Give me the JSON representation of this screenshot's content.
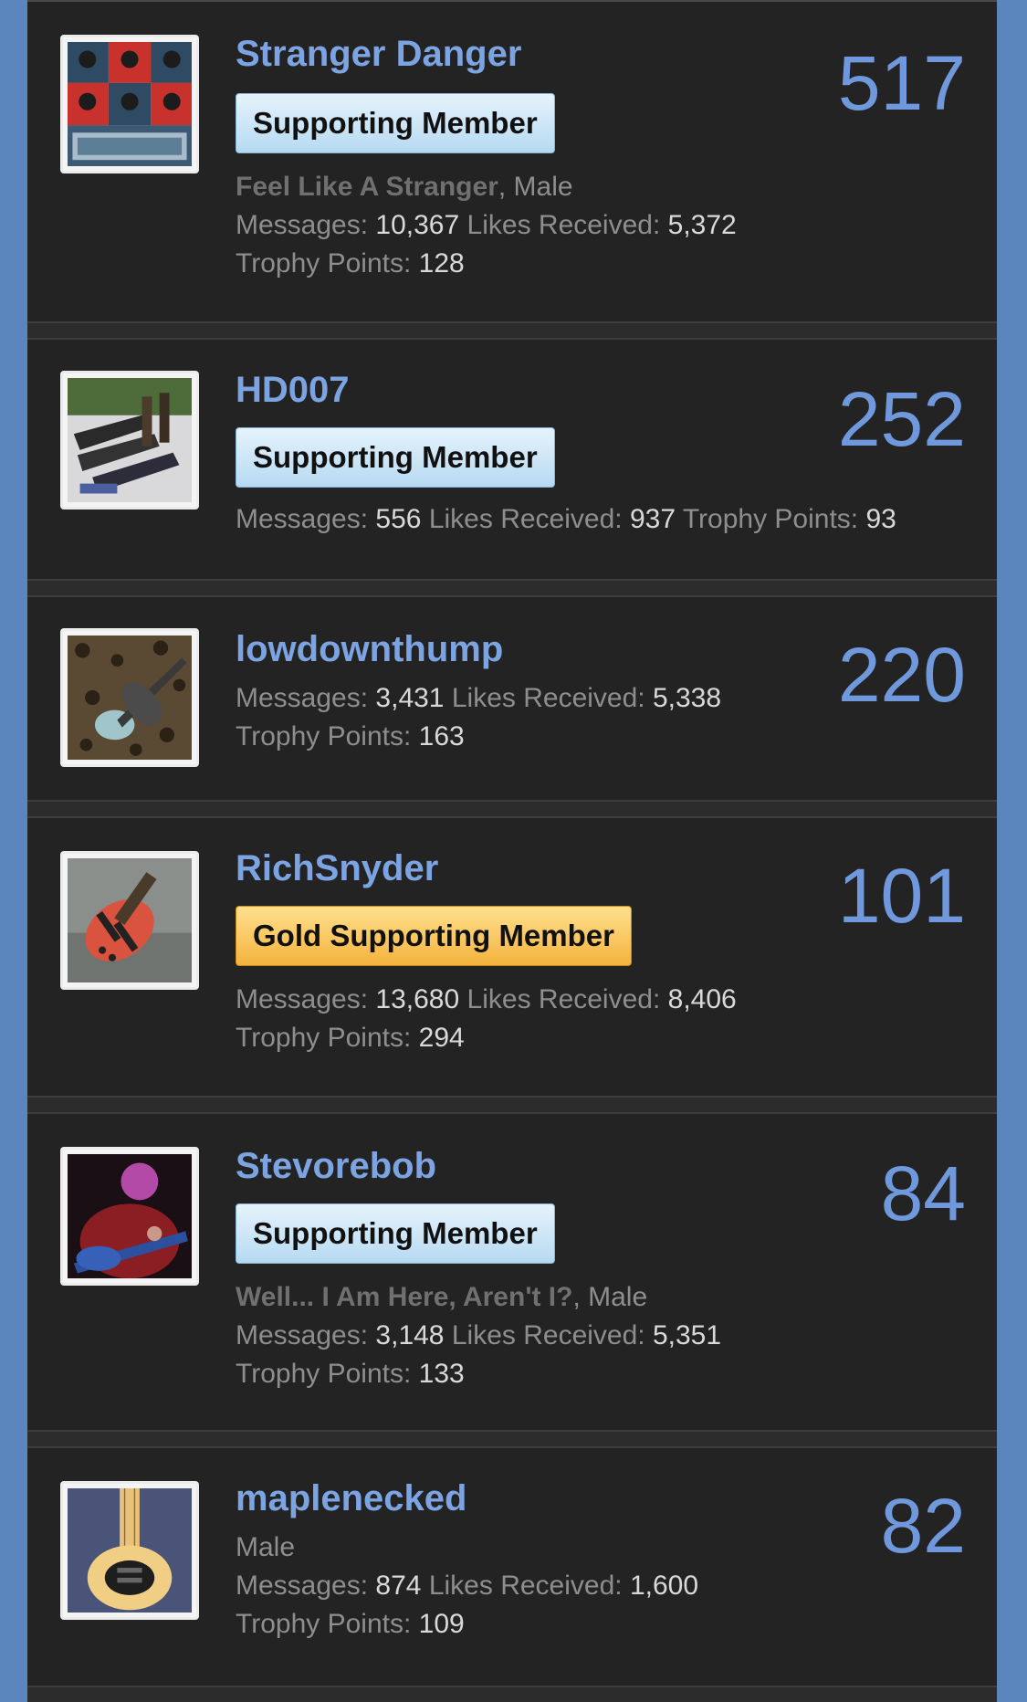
{
  "labels": {
    "messages": "Messages:",
    "likes": "Likes Received:",
    "trophy": "Trophy Points:",
    "comma": ", "
  },
  "colors": {
    "page_bg": "#5b85bd",
    "card_bg": "#232323",
    "username": "#7da4e2",
    "count": "#6f99dc",
    "badge_blue": "#b6daf2",
    "badge_gold": "#f4b33d"
  },
  "members": [
    {
      "username": "Stranger Danger",
      "count": "517",
      "badge": "Supporting Member",
      "custom_title": "Feel Like A Stranger",
      "gender": "Male",
      "messages": "10,367",
      "likes": "5,372",
      "trophy": "128",
      "avatar_icon": "hope-poster-avatar-icon"
    },
    {
      "username": "HD007",
      "count": "252",
      "badge": "Supporting Member",
      "messages": "556",
      "likes": "937",
      "trophy": "93",
      "avatar_icon": "bass-collection-avatar-icon"
    },
    {
      "username": "lowdownthump",
      "count": "220",
      "messages": "3,431",
      "likes": "5,338",
      "trophy": "163",
      "avatar_icon": "bass-on-leopard-print-avatar-icon"
    },
    {
      "username": "RichSnyder",
      "count": "101",
      "badge": "Gold Supporting Member",
      "messages": "13,680",
      "likes": "8,406",
      "trophy": "294",
      "avatar_icon": "red-bass-avatar-icon"
    },
    {
      "username": "Stevorebob",
      "count": "84",
      "badge": "Supporting Member",
      "custom_title": "Well... I Am Here, Aren't I?",
      "gender": "Male",
      "messages": "3,148",
      "likes": "5,351",
      "trophy": "133",
      "avatar_icon": "bassist-playing-avatar-icon"
    },
    {
      "username": "maplenecked",
      "count": "82",
      "gender": "Male",
      "messages": "874",
      "likes": "1,600",
      "trophy": "109",
      "avatar_icon": "maple-neck-bass-avatar-icon"
    }
  ]
}
